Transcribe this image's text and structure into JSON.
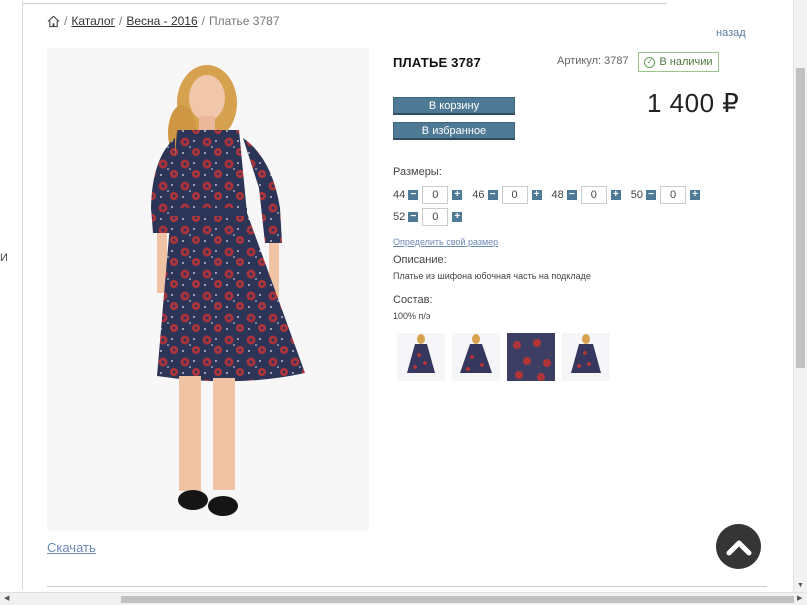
{
  "breadcrumb": {
    "home_icon": "home-icon",
    "items": [
      "Каталог",
      "Весна - 2016"
    ],
    "current": "Платье 3787",
    "separator": "/"
  },
  "back_link": "назад",
  "left_cut_text": "И",
  "product": {
    "title": "ПЛАТЬЕ 3787",
    "sku": "Артикул: 3787",
    "stock": "В наличии",
    "price": "1 400 ₽",
    "add_to_cart": "В корзину",
    "add_to_favorites": "В избранное"
  },
  "sizes": {
    "label": "Размеры:",
    "items": [
      {
        "size": "44",
        "qty": "0"
      },
      {
        "size": "46",
        "qty": "0"
      },
      {
        "size": "48",
        "qty": "0"
      },
      {
        "size": "50",
        "qty": "0"
      },
      {
        "size": "52",
        "qty": "0"
      }
    ],
    "minus": "−",
    "plus": "+",
    "find_size_link": "Определить свой размер"
  },
  "description": {
    "label": "Описание:",
    "text": "Платье из шифона юбочная часть на подкладе"
  },
  "composition": {
    "label": "Состав:",
    "text": "100% п/э"
  },
  "download_link": "Скачать",
  "colors": {
    "accent": "#4e7a96",
    "stock_green": "#4f7a40",
    "link_blue": "#6a88b8",
    "dress_navy": "#2c3558",
    "dress_red": "#b0353a"
  }
}
